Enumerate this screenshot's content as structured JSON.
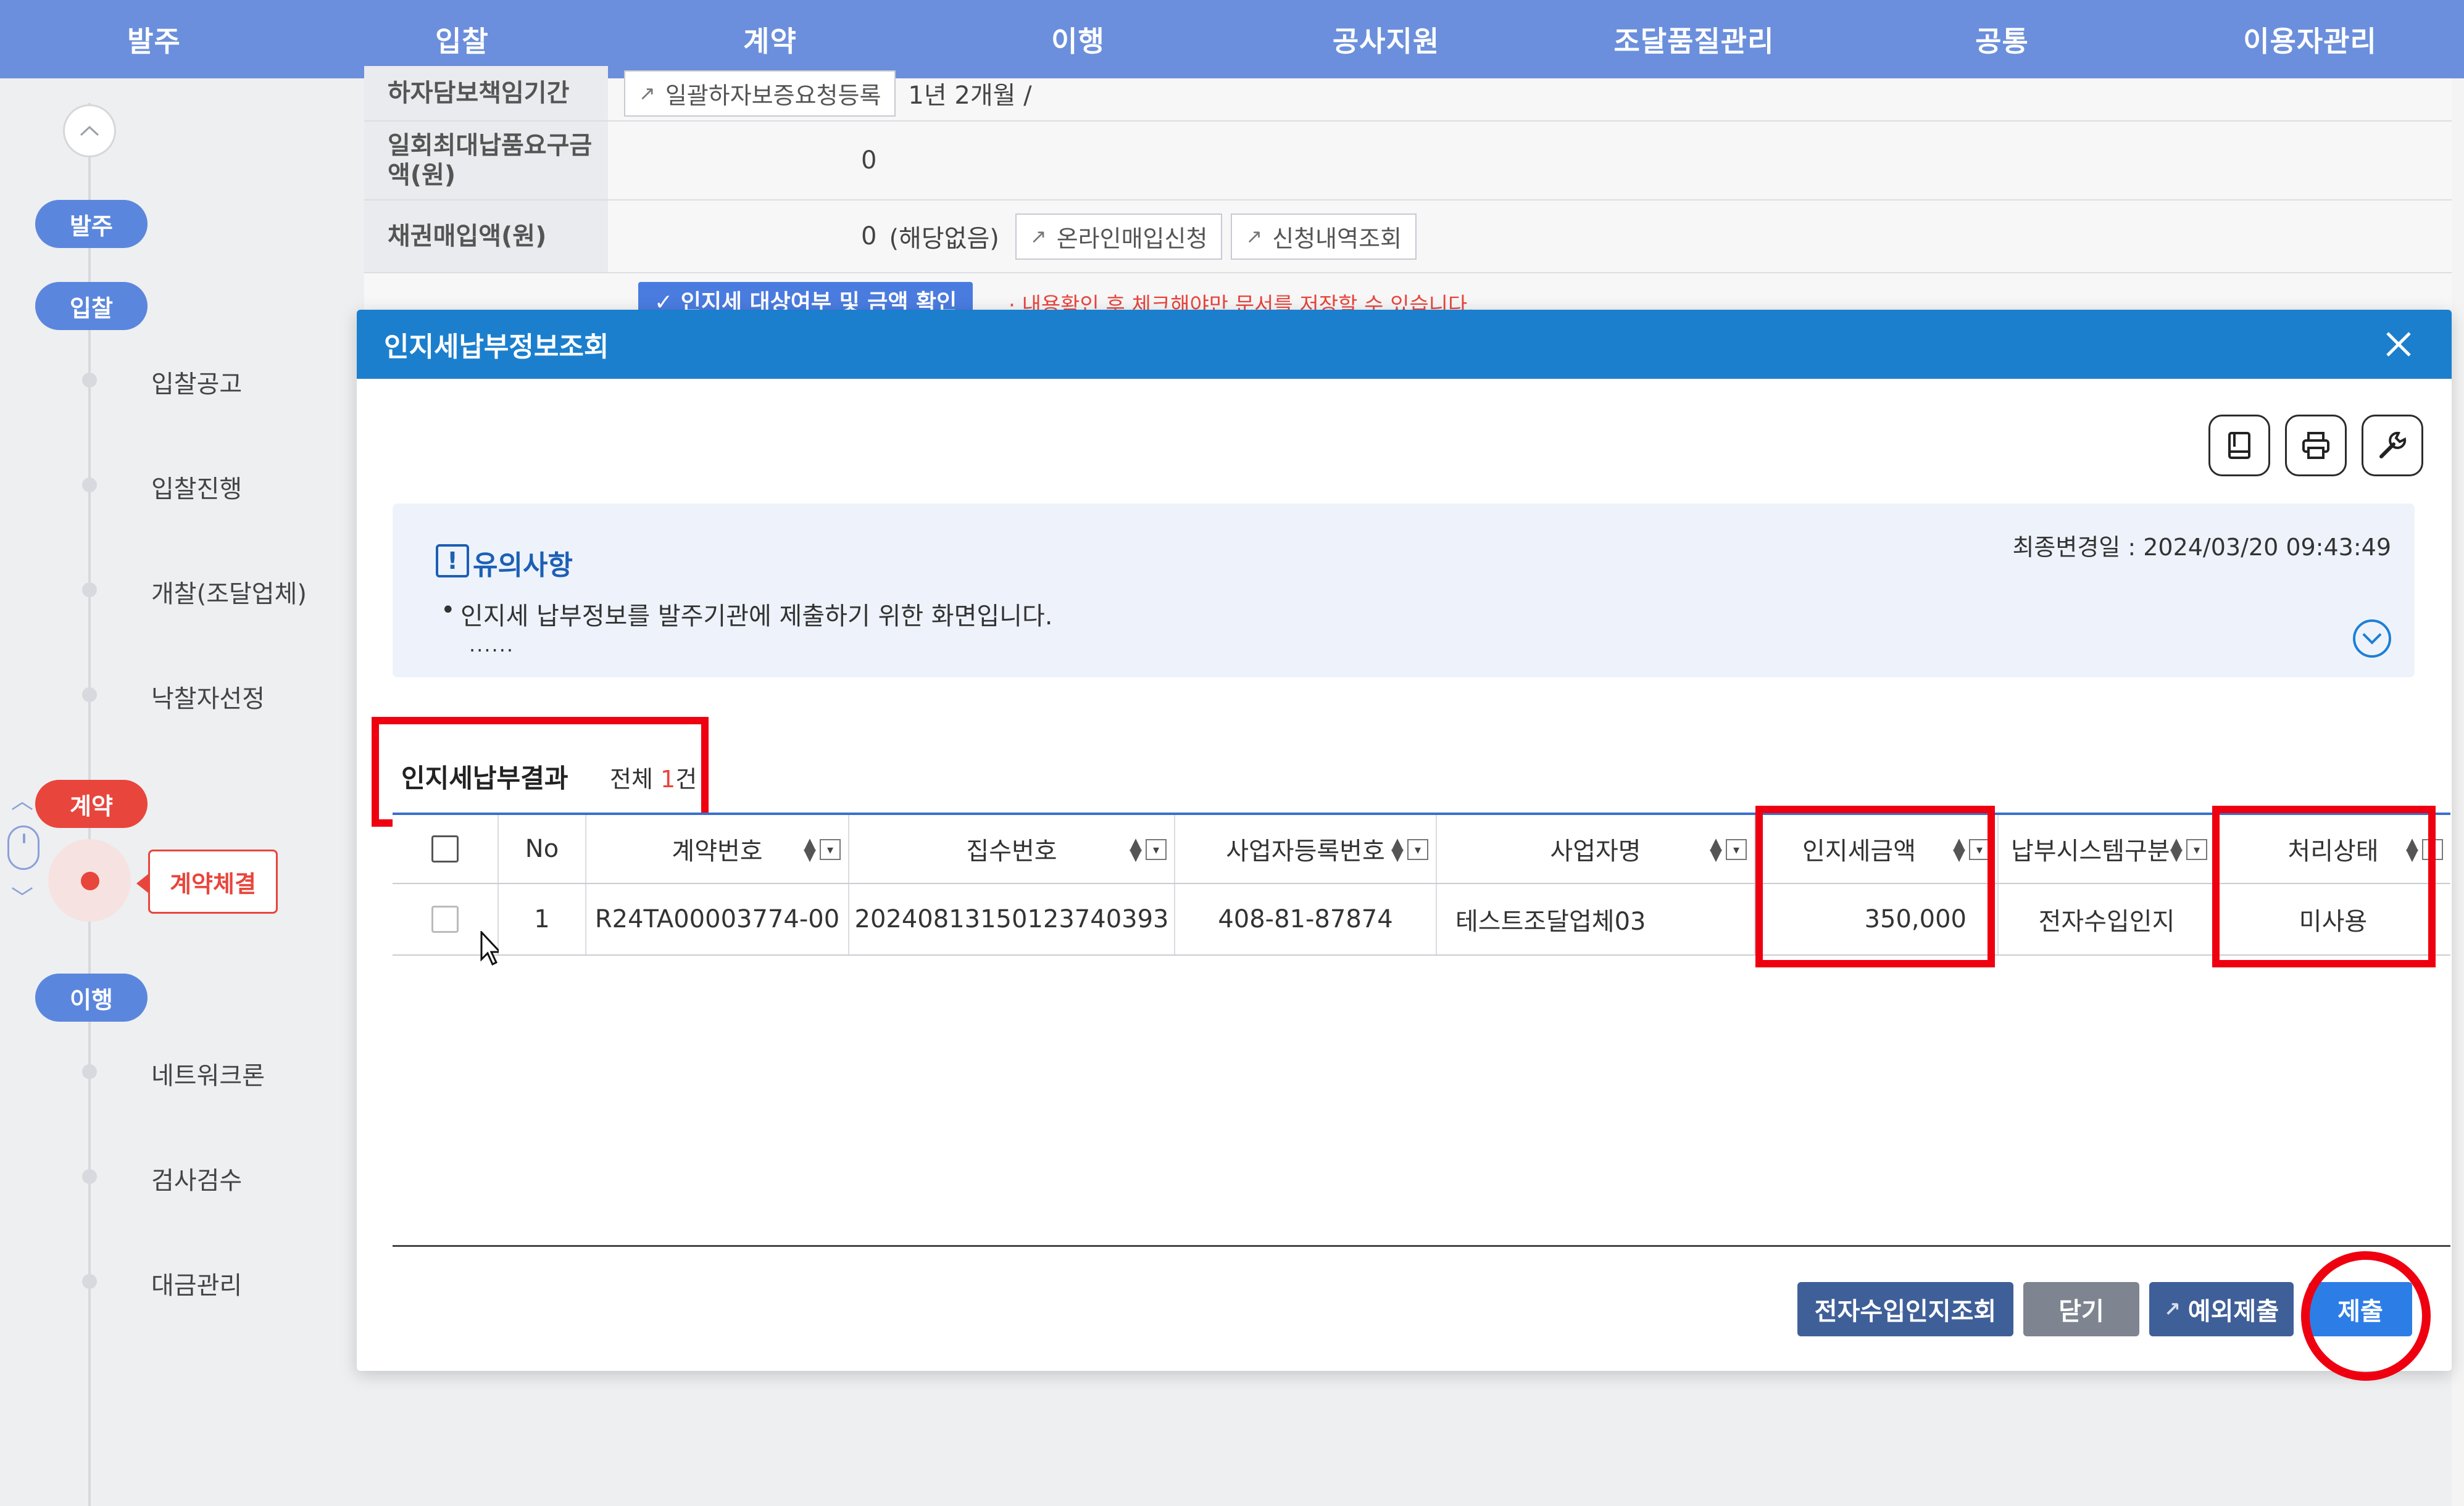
{
  "topnav": {
    "items": [
      "발주",
      "입찰",
      "계약",
      "이행",
      "공사지원",
      "조달품질관리",
      "공통",
      "이용자관리"
    ]
  },
  "sidebar": {
    "stages": {
      "order": "발주",
      "bid": "입찰",
      "contract": "계약",
      "execution": "이행"
    },
    "bid_items": [
      "입찰공고",
      "입찰진행",
      "개찰(조달업체)",
      "낙찰자선정"
    ],
    "contract_active": "계약체결",
    "execution_items": [
      "네트워크론",
      "검사검수",
      "대금관리"
    ]
  },
  "background_form": {
    "row1_label": "하자담보책임기간",
    "row1_button": "일괄하자보증요청등록",
    "row1_value": "1년 2개월 /",
    "row2_label": "일회최대납품요구금액(원)",
    "row2_value": "0",
    "row3_label": "채권매입액(원)",
    "row3_value": "0",
    "row3_note": "(해당없음)",
    "row3_button1": "온라인매입신청",
    "row3_button2": "신청내역조회",
    "check_button": "✓ 인지세 대상여부 및 금액 확인",
    "warning": "· 내용확인 후 체크해야만 문서를 저장할 수 있습니다."
  },
  "modal": {
    "title": "인지세납부정보조회",
    "notice": {
      "title": "유의사항",
      "text": "인지세 납부정보를 발주기관에 제출하기 위한 화면입니다.",
      "dots": "......",
      "last_modified": "최종변경일 : 2024/03/20 09:43:49"
    },
    "result": {
      "title": "인지세납부결과",
      "count_prefix": "전체",
      "count_num": "1",
      "count_suffix": "건"
    },
    "grid": {
      "columns": [
        "No",
        "계약번호",
        "집수번호",
        "사업자등록번호",
        "사업자명",
        "인지세금액",
        "납부시스템구분",
        "처리상태"
      ],
      "rows": [
        {
          "no": "1",
          "contract_no": "R24TA00003774-00",
          "receipt_no": "20240813150123740393",
          "biz_reg_no": "408-81-87874",
          "biz_name": "테스트조달업체03",
          "stamp_tax": "350,000",
          "payment_system": "전자수입인지",
          "status": "미사용"
        }
      ]
    },
    "buttons": {
      "stamp_lookup": "전자수입인지조회",
      "close": "닫기",
      "exception_submit": "예외제출",
      "submit": "제출"
    }
  }
}
